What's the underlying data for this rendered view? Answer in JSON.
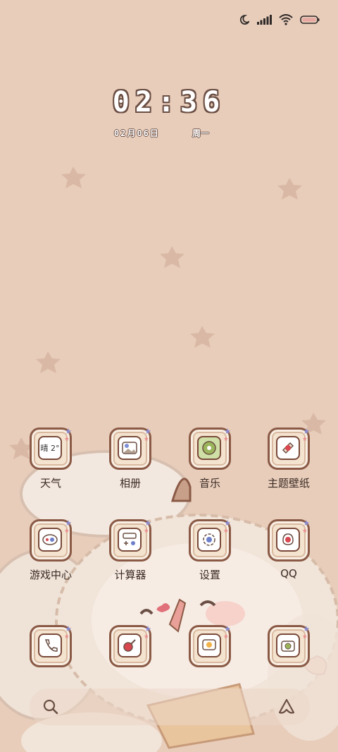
{
  "status_bar": {
    "icons": [
      "moon-icon",
      "signal-icon",
      "wifi-icon",
      "battery-icon"
    ]
  },
  "clock": {
    "time": "02:36",
    "date": "02月06日",
    "weekday": "周一"
  },
  "apps": [
    {
      "label": "天气",
      "icon": "weather-icon",
      "badge_text": "晴 2°"
    },
    {
      "label": "相册",
      "icon": "gallery-icon"
    },
    {
      "label": "音乐",
      "icon": "music-icon"
    },
    {
      "label": "主题壁纸",
      "icon": "themes-icon"
    },
    {
      "label": "游戏中心",
      "icon": "game-center-icon"
    },
    {
      "label": "计算器",
      "icon": "calculator-icon"
    },
    {
      "label": "设置",
      "icon": "settings-icon"
    },
    {
      "label": "QQ",
      "icon": "qq-icon"
    }
  ],
  "dock_apps": [
    {
      "icon": "phone-icon"
    },
    {
      "icon": "browser-icon"
    },
    {
      "icon": "messages-icon"
    },
    {
      "icon": "camera-icon"
    }
  ],
  "dock_bar": {
    "left_icon": "search-icon",
    "right_icon": "assistant-icon"
  },
  "colors": {
    "background": "#e8cdbb",
    "icon_border": "#8a5a46",
    "label": "#3a2a24"
  }
}
